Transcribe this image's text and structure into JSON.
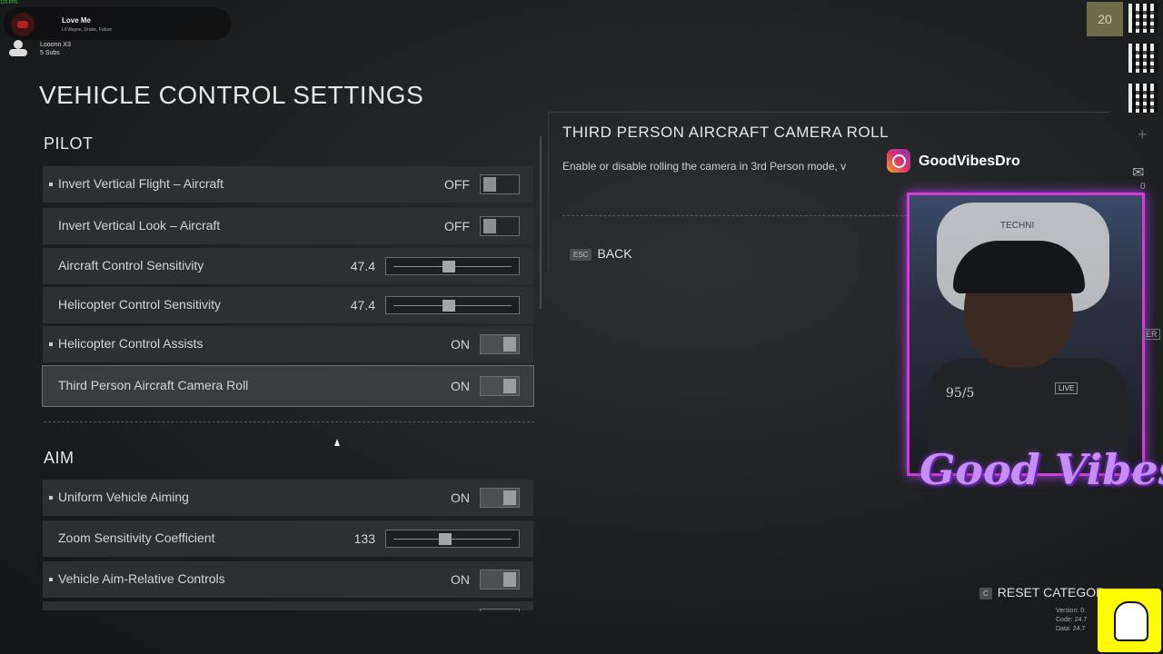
{
  "overlay": {
    "fps": "120 FPS",
    "now_playing_title": "Love Me",
    "now_playing_artist": "Lil Wayne, Drake, Future",
    "sub_name": "Looonn X3",
    "sub_count": "5 Subs"
  },
  "page": {
    "title": "VEHICLE CONTROL SETTINGS"
  },
  "sections": {
    "pilot": "PILOT",
    "aim": "AIM"
  },
  "pilot_rows": [
    {
      "label": "Invert Vertical Flight – Aircraft",
      "value": "OFF",
      "type": "toggle",
      "state": "off",
      "bullet": true
    },
    {
      "label": "Invert Vertical Look – Aircraft",
      "value": "OFF",
      "type": "toggle",
      "state": "off",
      "bullet": false
    },
    {
      "label": "Aircraft Control Sensitivity",
      "value": "47.4",
      "type": "slider",
      "level": 0.47,
      "bullet": false
    },
    {
      "label": "Helicopter Control Sensitivity",
      "value": "47.4",
      "type": "slider",
      "level": 0.47,
      "bullet": false
    },
    {
      "label": "Helicopter Control Assists",
      "value": "ON",
      "type": "toggle",
      "state": "on",
      "bullet": true
    },
    {
      "label": "Third Person Aircraft Camera Roll",
      "value": "ON",
      "type": "toggle",
      "state": "on",
      "bullet": false,
      "selected": true
    }
  ],
  "aim_rows": [
    {
      "label": "Uniform Vehicle Aiming",
      "value": "ON",
      "type": "toggle",
      "state": "on",
      "bullet": true
    },
    {
      "label": "Zoom Sensitivity Coefficient",
      "value": "133",
      "type": "slider",
      "level": 0.44,
      "bullet": false
    },
    {
      "label": "Vehicle Aim-Relative Controls",
      "value": "ON",
      "type": "toggle",
      "state": "on",
      "bullet": true
    }
  ],
  "detail": {
    "title": "THIRD PERSON AIRCRAFT CAMERA ROLL",
    "description": "Enable or disable rolling the camera in 3rd Person mode, v",
    "back_key": "ESC",
    "back_label": "BACK"
  },
  "social": {
    "instagram": "GoodVibesDro",
    "brand": "Good Vibes",
    "cam_jersey": "95/5",
    "cam_live": "LIVE",
    "cam_chair": "TECHNI"
  },
  "sidebar": {
    "count": "20",
    "mail_count": "0",
    "er_label": "ER"
  },
  "footer": {
    "reset_key": "C",
    "reset_label": "RESET CATEGOR",
    "version_lines": [
      "Version: 0.",
      "Code: 24.7",
      "Data: 24.7"
    ]
  },
  "colors": {
    "accent_frame": "#d23bd8",
    "brand_text": "#c68df5",
    "snapchat": "#fffc00"
  }
}
